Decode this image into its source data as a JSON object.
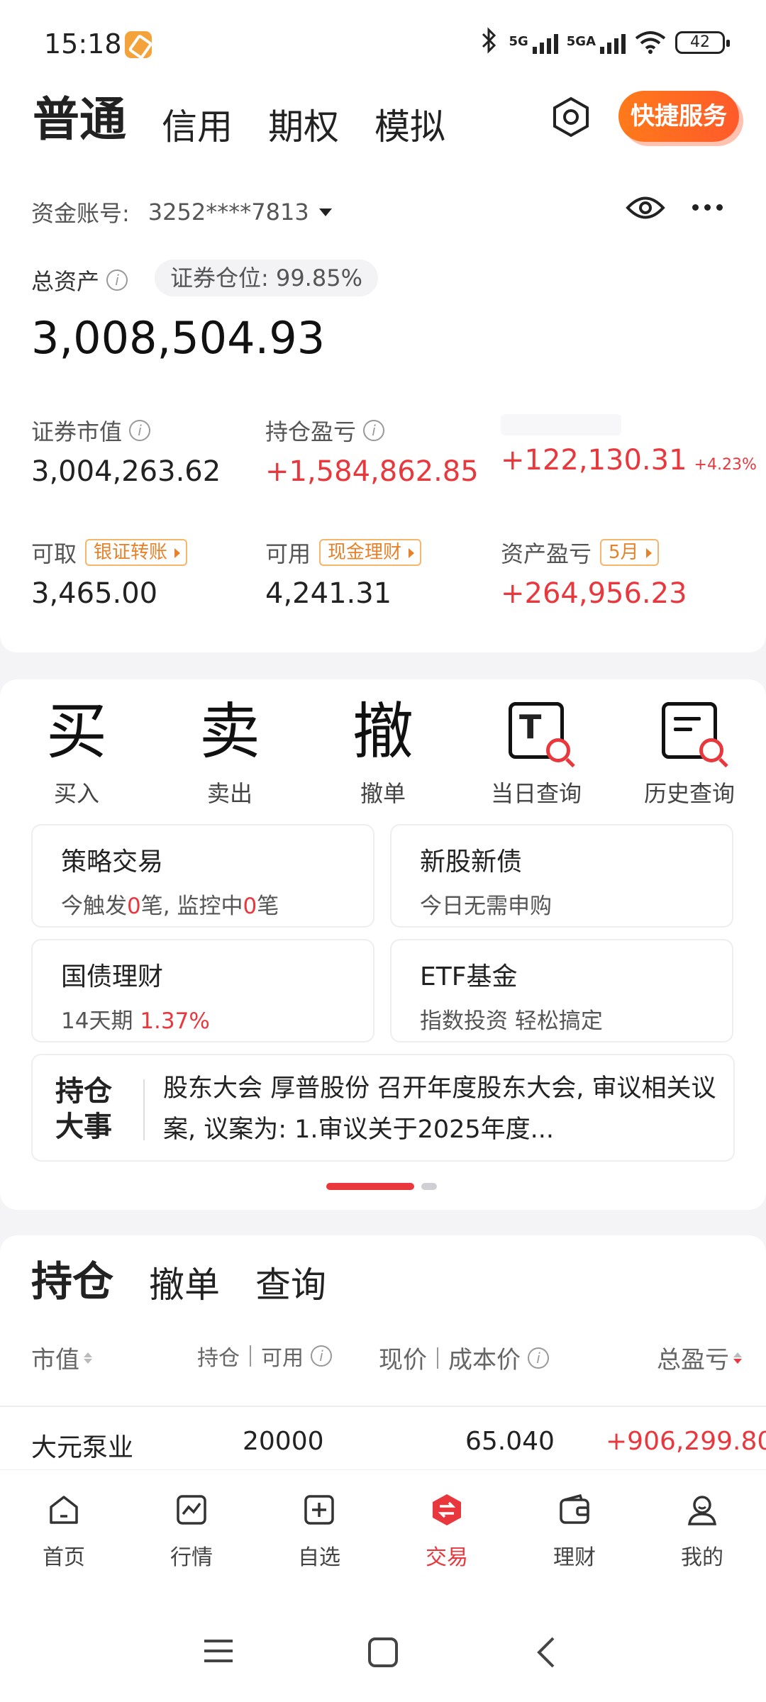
{
  "status": {
    "time": "15:18",
    "sig1": "5G",
    "sig2": "5GA",
    "battery": "42"
  },
  "tabs": [
    "普通",
    "信用",
    "期权",
    "模拟"
  ],
  "quick_service": "快捷服务",
  "account": {
    "label": "资金账号:",
    "number": "3252****7813"
  },
  "assets": {
    "total_label": "总资产",
    "position_ratio": "证券仓位: 99.85%",
    "total": "3,008,504.93",
    "market_value_label": "证券市值",
    "market_value": "3,004,263.62",
    "holding_pl_label": "持仓盈亏",
    "holding_pl": "+1,584,862.85",
    "today_pl": "+122,130.31",
    "today_pl_pct": "+4.23%",
    "withdrawable_label": "可取",
    "transfer_tag": "银证转账",
    "withdrawable": "3,465.00",
    "available_label": "可用",
    "cash_tag": "现金理财",
    "available": "4,241.31",
    "asset_pl_label": "资产盈亏",
    "month_tag": "5月",
    "asset_pl": "+264,956.23"
  },
  "actions": [
    {
      "glyph_a": "买",
      "label": "买入"
    },
    {
      "glyph_a": "卖",
      "label": "卖出"
    },
    {
      "glyph_a": "撤",
      "label": "撤单"
    },
    {
      "glyph_a": "T",
      "label": "当日查询"
    },
    {
      "glyph_a": "",
      "label": "历史查询"
    }
  ],
  "tiles": {
    "strategy": {
      "title": "策略交易",
      "sub_a": "今触发",
      "count1": "0",
      "sub_b": "笔, 监控中",
      "count2": "0",
      "sub_c": "笔"
    },
    "ipo": {
      "title": "新股新债",
      "sub": "今日无需申购"
    },
    "bond": {
      "title": "国债理财",
      "sub": "14天期",
      "rate": "1.37%"
    },
    "etf": {
      "title": "ETF基金",
      "sub": "指数投资 轻松搞定"
    }
  },
  "news": {
    "badge": "持仓大事",
    "text": "股东大会 厚普股份 召开年度股东大会, 审议相关议案, 议案为: 1.审议关于2025年度..."
  },
  "holdings": {
    "tabs": [
      "持仓",
      "撤单",
      "查询"
    ],
    "col_value": "市值",
    "col_qty": "持仓",
    "col_avail": "可用",
    "col_price": "现价",
    "col_cost": "成本价",
    "col_pl": "总盈亏",
    "rows": [
      {
        "name": "大元泵业",
        "qty": "20000",
        "price": "65.040",
        "pl": "+906,299.80"
      }
    ]
  },
  "bottom_nav": [
    "首页",
    "行情",
    "自选",
    "交易",
    "理财",
    "我的"
  ],
  "colors": {
    "accent_red": "#e8383d",
    "orange": "#e7822b"
  }
}
